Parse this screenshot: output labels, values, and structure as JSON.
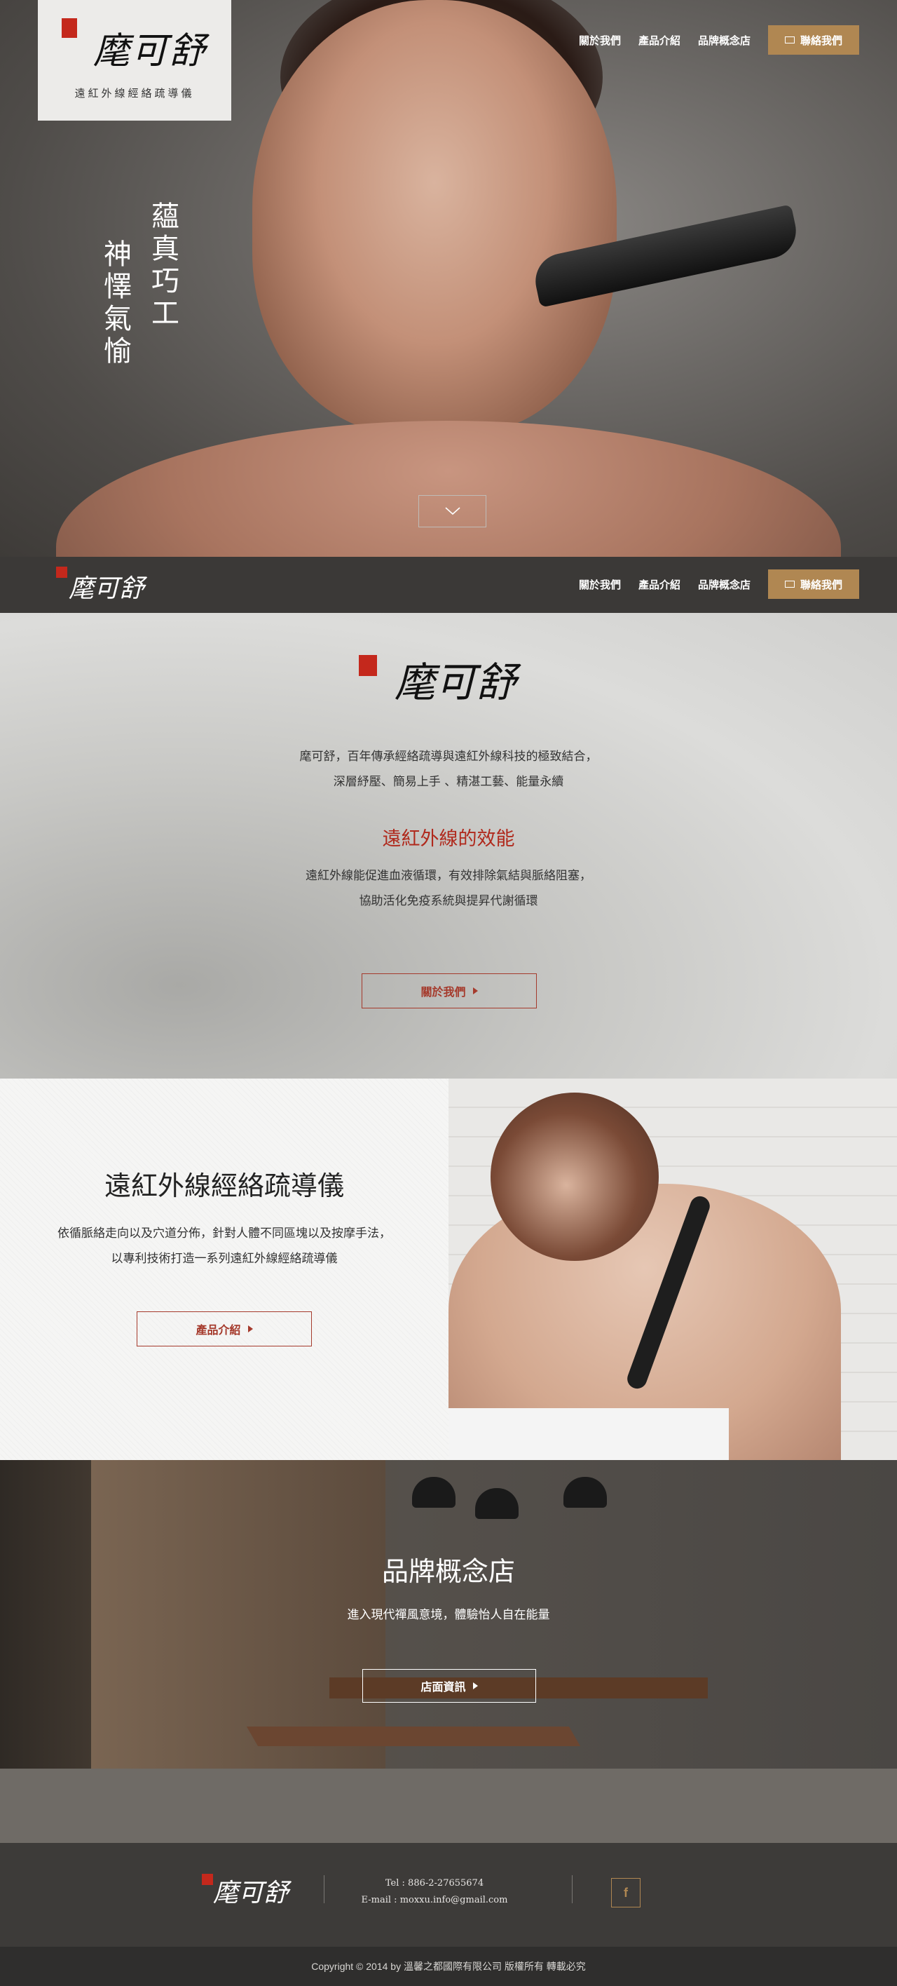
{
  "brand": {
    "name": "麾可舒",
    "tagline": "遠紅外線經絡疏導儀"
  },
  "nav": {
    "about": "關於我們",
    "products": "產品介紹",
    "store": "品牌概念店",
    "contact": "聯絡我們"
  },
  "hero": {
    "slogan_1": "蘊真巧工",
    "slogan_2": "神懌氣愉",
    "scroll_icon": "chevron-down-icon"
  },
  "intro": {
    "line_1": "麾可舒，百年傳承經絡疏導與遠紅外線科技的極致結合，",
    "line_2": "深層紓壓、簡易上手 、精湛工藝、能量永續",
    "heading": "遠紅外線的效能",
    "line_3": "遠紅外線能促進血液循環，有效排除氣結與脈絡阻塞，",
    "line_4": "協助活化免疫系統與提昇代謝循環",
    "button": "關於我們"
  },
  "product": {
    "heading": "遠紅外線經絡疏導儀",
    "line_1": "依循脈絡走向以及穴道分佈，針對人體不同區塊以及按摩手法，",
    "line_2": "以專利技術打造一系列遠紅外線經絡疏導儀",
    "button": "產品介紹"
  },
  "store": {
    "heading": "品牌概念店",
    "text": "進入現代禪風意境，體驗怡人自在能量",
    "button": "店面資訊"
  },
  "footer": {
    "tel": "Tel : 886-2-27655674",
    "email": "E-mail :  moxxu.info@gmail.com",
    "facebook": "f",
    "copyright": "Copyright © 2014 by 溫馨之都國際有限公司 版權所有 轉載必究"
  },
  "colors": {
    "accent_gold": "#b08752",
    "accent_red": "#b0291c",
    "dark_bar": "#3b3937"
  }
}
